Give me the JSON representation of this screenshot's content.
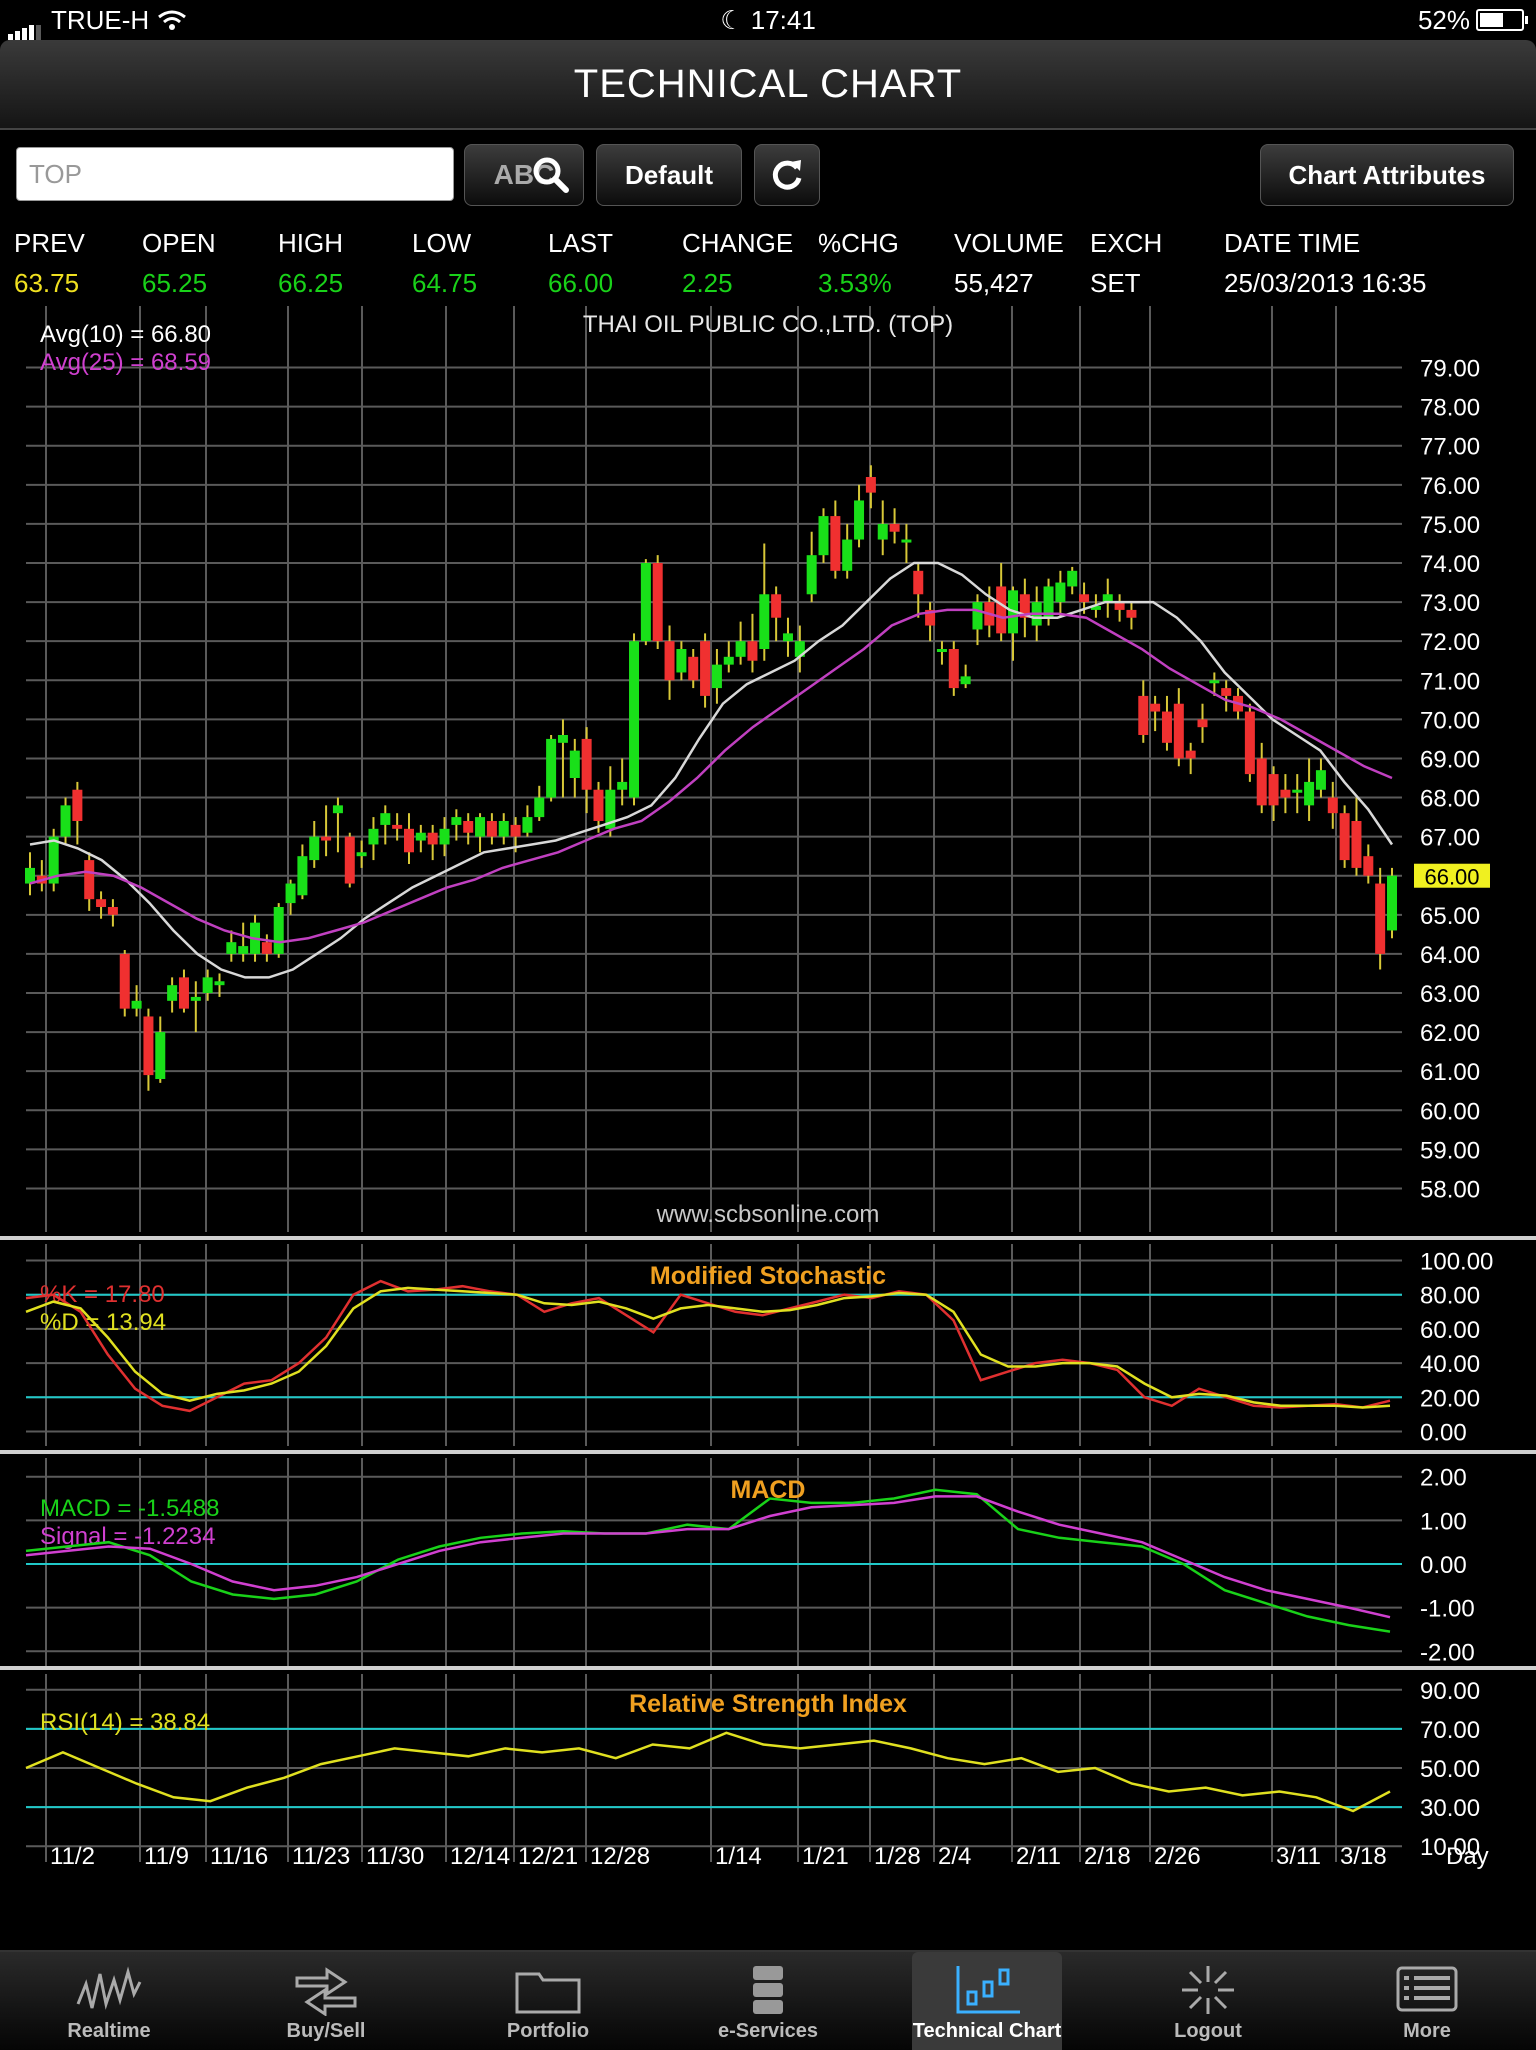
{
  "status_bar": {
    "carrier": "TRUE-H",
    "time": "17:41",
    "battery": "52%"
  },
  "title": "TECHNICAL CHART",
  "toolbar": {
    "symbol_placeholder": "TOP",
    "search_label": "ABC",
    "default_label": "Default",
    "attributes_label": "Chart Attributes"
  },
  "quote": {
    "headers": [
      "PREV",
      "OPEN",
      "HIGH",
      "LOW",
      "LAST",
      "CHANGE",
      "%CHG",
      "VOLUME",
      "EXCH",
      "DATE TIME"
    ],
    "values": [
      "63.75",
      "65.25",
      "66.25",
      "64.75",
      "66.00",
      "2.25",
      "3.53%",
      "55,427",
      "SET",
      "25/03/2013 16:35"
    ],
    "value_colors": [
      "#f0e020",
      "#19d219",
      "#19d219",
      "#19d219",
      "#19d219",
      "#19d219",
      "#19d219",
      "#ffffff",
      "#ffffff",
      "#ffffff"
    ]
  },
  "chart_data": [
    {
      "type": "candlestick",
      "title": "THAI OIL PUBLIC CO.,LTD. (TOP)",
      "watermark": "www.scbsonline.com",
      "ylim": [
        57.5,
        79.5
      ],
      "yticks": [
        "79.00",
        "78.00",
        "77.00",
        "76.00",
        "75.00",
        "74.00",
        "73.00",
        "72.00",
        "71.00",
        "70.00",
        "69.00",
        "68.00",
        "67.00",
        "66.00",
        "65.00",
        "64.00",
        "63.00",
        "62.00",
        "61.00",
        "60.00",
        "59.00",
        "58.00"
      ],
      "last_marker": "66.00",
      "legend": [
        {
          "label": "Avg(10)  =  66.80",
          "color": "#ffffff"
        },
        {
          "label": "Avg(25)  =  68.59",
          "color": "#d040d0"
        }
      ],
      "candles": [
        [
          65.8,
          66.2,
          65.5,
          66.6
        ],
        [
          66.0,
          65.8,
          65.6,
          66.4
        ],
        [
          65.8,
          67.0,
          65.6,
          67.2
        ],
        [
          67.0,
          67.8,
          66.8,
          68.0
        ],
        [
          68.2,
          67.4,
          66.8,
          68.4
        ],
        [
          66.4,
          65.4,
          65.1,
          66.6
        ],
        [
          65.4,
          65.2,
          64.9,
          65.6
        ],
        [
          65.2,
          65.0,
          64.7,
          65.4
        ],
        [
          64.0,
          62.6,
          62.4,
          64.1
        ],
        [
          62.6,
          62.8,
          62.4,
          63.2
        ],
        [
          62.4,
          60.9,
          60.5,
          62.6
        ],
        [
          60.8,
          62.0,
          60.7,
          62.4
        ],
        [
          62.8,
          63.2,
          62.5,
          63.4
        ],
        [
          63.4,
          62.6,
          62.5,
          63.6
        ],
        [
          62.8,
          62.9,
          62.0,
          63.3
        ],
        [
          63.0,
          63.4,
          62.8,
          63.6
        ],
        [
          63.2,
          63.3,
          62.9,
          63.5
        ],
        [
          64.0,
          64.3,
          63.8,
          64.6
        ],
        [
          64.0,
          64.2,
          63.8,
          64.8
        ],
        [
          64.0,
          64.8,
          63.8,
          65.0
        ],
        [
          64.3,
          64.0,
          63.8,
          64.5
        ],
        [
          64.0,
          65.2,
          63.9,
          65.3
        ],
        [
          65.3,
          65.8,
          65.0,
          65.9
        ],
        [
          65.5,
          66.5,
          65.4,
          66.8
        ],
        [
          66.4,
          67.0,
          66.2,
          67.4
        ],
        [
          67.0,
          66.9,
          66.5,
          67.8
        ],
        [
          67.6,
          67.8,
          66.6,
          68.0
        ],
        [
          67.0,
          65.8,
          65.7,
          67.1
        ],
        [
          66.5,
          66.6,
          66.2,
          66.9
        ],
        [
          66.8,
          67.2,
          66.4,
          67.5
        ],
        [
          67.3,
          67.6,
          66.8,
          67.8
        ],
        [
          67.3,
          67.2,
          66.9,
          67.6
        ],
        [
          67.2,
          66.6,
          66.3,
          67.6
        ],
        [
          66.9,
          67.1,
          66.6,
          67.3
        ],
        [
          67.1,
          66.8,
          66.4,
          67.3
        ],
        [
          66.8,
          67.2,
          66.5,
          67.5
        ],
        [
          67.3,
          67.5,
          66.9,
          67.7
        ],
        [
          67.4,
          67.1,
          66.8,
          67.6
        ],
        [
          67.0,
          67.5,
          66.6,
          67.6
        ],
        [
          67.4,
          67.0,
          66.8,
          67.6
        ],
        [
          67.0,
          67.4,
          66.8,
          67.6
        ],
        [
          67.3,
          67.0,
          66.6,
          67.5
        ],
        [
          67.1,
          67.5,
          67.0,
          67.8
        ],
        [
          67.5,
          68.0,
          67.4,
          68.3
        ],
        [
          68.0,
          69.5,
          67.9,
          69.6
        ],
        [
          69.4,
          69.6,
          68.0,
          70.0
        ],
        [
          68.5,
          69.2,
          68.0,
          69.5
        ],
        [
          69.5,
          68.2,
          67.6,
          69.8
        ],
        [
          68.2,
          67.4,
          67.1,
          68.4
        ],
        [
          67.2,
          68.2,
          67.0,
          68.8
        ],
        [
          68.2,
          68.4,
          67.8,
          69.0
        ],
        [
          68.0,
          72.0,
          67.8,
          72.2
        ],
        [
          72.0,
          74.0,
          71.9,
          74.1
        ],
        [
          74.0,
          72.0,
          71.8,
          74.2
        ],
        [
          72.0,
          71.0,
          70.5,
          72.4
        ],
        [
          71.2,
          71.8,
          71.0,
          72.0
        ],
        [
          71.6,
          71.0,
          70.8,
          71.8
        ],
        [
          72.0,
          70.6,
          70.3,
          72.2
        ],
        [
          70.8,
          71.4,
          70.4,
          71.8
        ],
        [
          71.4,
          71.6,
          71.2,
          72.0
        ],
        [
          71.6,
          72.0,
          71.4,
          72.5
        ],
        [
          72.0,
          71.5,
          71.2,
          72.7
        ],
        [
          71.8,
          73.2,
          71.5,
          74.5
        ],
        [
          73.2,
          72.6,
          72.0,
          73.4
        ],
        [
          72.0,
          72.2,
          71.6,
          72.6
        ],
        [
          71.6,
          72.0,
          71.2,
          72.4
        ],
        [
          73.2,
          74.2,
          73.0,
          74.8
        ],
        [
          74.2,
          75.2,
          74.0,
          75.4
        ],
        [
          75.2,
          73.8,
          73.6,
          75.6
        ],
        [
          73.8,
          74.6,
          73.6,
          75.0
        ],
        [
          74.6,
          75.6,
          74.4,
          76.0
        ],
        [
          76.2,
          75.8,
          75.4,
          76.5
        ],
        [
          74.6,
          75.0,
          74.2,
          75.6
        ],
        [
          75.0,
          74.8,
          74.5,
          75.4
        ],
        [
          74.6,
          74.6,
          74.0,
          75.0
        ],
        [
          73.8,
          73.2,
          72.6,
          74.0
        ],
        [
          72.8,
          72.4,
          72.0,
          73.0
        ],
        [
          71.8,
          71.8,
          71.4,
          72.0
        ],
        [
          71.8,
          70.8,
          70.6,
          72.0
        ],
        [
          70.9,
          71.1,
          70.8,
          71.4
        ],
        [
          72.3,
          73.0,
          71.9,
          73.2
        ],
        [
          73.0,
          72.4,
          72.1,
          73.4
        ],
        [
          73.4,
          72.2,
          72.0,
          74.0
        ],
        [
          72.2,
          73.3,
          71.5,
          73.4
        ],
        [
          73.2,
          72.6,
          72.1,
          73.6
        ],
        [
          72.4,
          73.0,
          72.0,
          73.4
        ],
        [
          72.6,
          73.4,
          72.4,
          73.6
        ],
        [
          73.0,
          73.5,
          72.6,
          73.8
        ],
        [
          73.4,
          73.8,
          73.2,
          73.9
        ],
        [
          73.2,
          73.0,
          72.7,
          73.5
        ],
        [
          72.8,
          72.9,
          72.6,
          73.2
        ],
        [
          73.0,
          73.2,
          72.6,
          73.6
        ],
        [
          73.0,
          72.8,
          72.5,
          73.2
        ],
        [
          72.8,
          72.6,
          72.3,
          73.0
        ],
        [
          70.6,
          69.6,
          69.4,
          71.0
        ],
        [
          70.4,
          70.2,
          69.7,
          70.6
        ],
        [
          70.2,
          69.4,
          69.2,
          70.6
        ],
        [
          70.4,
          69.0,
          68.8,
          70.8
        ],
        [
          69.2,
          69.0,
          68.6,
          69.4
        ],
        [
          70.0,
          69.8,
          69.4,
          70.4
        ],
        [
          71.0,
          71.0,
          70.6,
          71.2
        ],
        [
          70.8,
          70.6,
          70.2,
          71.0
        ],
        [
          70.6,
          70.2,
          70.0,
          70.8
        ],
        [
          70.2,
          68.6,
          68.4,
          70.4
        ],
        [
          69.0,
          67.8,
          67.6,
          69.4
        ],
        [
          68.6,
          67.8,
          67.4,
          68.8
        ],
        [
          68.2,
          68.0,
          67.6,
          68.6
        ],
        [
          68.2,
          68.2,
          67.6,
          68.6
        ],
        [
          67.8,
          68.4,
          67.4,
          69.0
        ],
        [
          68.2,
          68.7,
          68.0,
          69.0
        ],
        [
          68.0,
          67.6,
          67.2,
          68.4
        ],
        [
          67.6,
          66.4,
          66.2,
          67.8
        ],
        [
          67.4,
          66.2,
          66.0,
          68.0
        ],
        [
          66.5,
          66.0,
          65.8,
          66.8
        ],
        [
          65.8,
          64.0,
          63.6,
          66.2
        ],
        [
          64.6,
          66.0,
          64.4,
          66.2
        ]
      ],
      "ma10": [
        66.8,
        66.9,
        66.7,
        66.4,
        65.9,
        65.3,
        64.6,
        64.0,
        63.6,
        63.4,
        63.4,
        63.6,
        64.0,
        64.4,
        64.9,
        65.3,
        65.7,
        66.0,
        66.3,
        66.6,
        66.7,
        66.8,
        66.9,
        67.1,
        67.3,
        67.5,
        67.8,
        68.5,
        69.5,
        70.4,
        70.9,
        71.2,
        71.5,
        72.0,
        72.4,
        73.0,
        73.6,
        74.0,
        74.0,
        73.7,
        73.2,
        72.8,
        72.6,
        72.6,
        72.8,
        73.0,
        73.0,
        73.0,
        72.6,
        72.0,
        71.2,
        70.6,
        70.0,
        69.6,
        69.2,
        68.4,
        67.7,
        66.8
      ],
      "ma25": [
        65.8,
        66.0,
        66.1,
        66.0,
        65.7,
        65.3,
        64.9,
        64.6,
        64.4,
        64.3,
        64.4,
        64.6,
        64.8,
        65.1,
        65.4,
        65.7,
        65.9,
        66.2,
        66.4,
        66.6,
        66.9,
        67.2,
        67.4,
        67.9,
        68.5,
        69.2,
        69.8,
        70.3,
        70.8,
        71.3,
        71.8,
        72.4,
        72.7,
        72.8,
        72.8,
        72.6,
        72.7,
        72.7,
        72.6,
        72.2,
        71.8,
        71.3,
        70.9,
        70.5,
        70.3,
        70.0,
        69.6,
        69.2,
        68.8,
        68.5
      ]
    },
    {
      "type": "line",
      "title": "Modified Stochastic",
      "ylim": [
        -5,
        105
      ],
      "yticks": [
        "100.00",
        "80.00",
        "60.00",
        "40.00",
        "20.00",
        "0.00"
      ],
      "reference_lines": [
        80,
        20
      ],
      "legend": [
        {
          "label": "%K  =  17.80",
          "color": "#e03030"
        },
        {
          "label": "%D  =  13.94",
          "color": "#e0e020"
        }
      ],
      "series": [
        {
          "name": "%K",
          "color": "#e03030",
          "values": [
            78,
            80,
            70,
            45,
            25,
            15,
            12,
            20,
            28,
            30,
            40,
            55,
            80,
            88,
            82,
            83,
            85,
            82,
            80,
            70,
            75,
            78,
            68,
            58,
            80,
            75,
            70,
            68,
            72,
            76,
            80,
            78,
            82,
            80,
            65,
            30,
            35,
            40,
            42,
            40,
            36,
            20,
            15,
            25,
            20,
            15,
            14,
            15,
            16,
            14,
            18
          ]
        },
        {
          "name": "%D",
          "color": "#e0e020",
          "values": [
            70,
            76,
            72,
            55,
            35,
            22,
            18,
            22,
            24,
            28,
            35,
            50,
            72,
            82,
            84,
            83,
            82,
            81,
            80,
            75,
            74,
            76,
            72,
            66,
            72,
            74,
            72,
            70,
            71,
            74,
            78,
            79,
            81,
            80,
            70,
            45,
            38,
            38,
            40,
            40,
            38,
            28,
            20,
            22,
            21,
            17,
            15,
            15,
            15,
            14,
            15
          ]
        }
      ]
    },
    {
      "type": "line",
      "title": "MACD",
      "ylim": [
        -2.2,
        2.2
      ],
      "yticks": [
        "2.00",
        "1.00",
        "0.00",
        "-1.00",
        "-2.00"
      ],
      "reference_lines": [
        0
      ],
      "legend": [
        {
          "label": "MACD  =  -1.5488",
          "color": "#19d219"
        },
        {
          "label": "Signal  =  -1.2234",
          "color": "#d040d0"
        }
      ],
      "series": [
        {
          "name": "MACD",
          "color": "#19d219",
          "values": [
            0.3,
            0.4,
            0.5,
            0.2,
            -0.4,
            -0.7,
            -0.8,
            -0.7,
            -0.4,
            0.1,
            0.4,
            0.6,
            0.7,
            0.75,
            0.7,
            0.7,
            0.9,
            0.8,
            1.5,
            1.4,
            1.4,
            1.5,
            1.7,
            1.6,
            0.8,
            0.6,
            0.5,
            0.4,
            0.0,
            -0.6,
            -0.9,
            -1.2,
            -1.4,
            -1.55
          ]
        },
        {
          "name": "Signal",
          "color": "#d040d0",
          "values": [
            0.2,
            0.3,
            0.4,
            0.35,
            0.0,
            -0.4,
            -0.6,
            -0.5,
            -0.3,
            0.0,
            0.3,
            0.5,
            0.6,
            0.7,
            0.7,
            0.7,
            0.8,
            0.8,
            1.1,
            1.3,
            1.35,
            1.4,
            1.55,
            1.55,
            1.2,
            0.9,
            0.7,
            0.5,
            0.1,
            -0.3,
            -0.6,
            -0.8,
            -1.0,
            -1.22
          ]
        }
      ]
    },
    {
      "type": "line",
      "title": "Relative Strength Index",
      "ylim": [
        5,
        95
      ],
      "yticks": [
        "90.00",
        "70.00",
        "50.00",
        "30.00",
        "10.00"
      ],
      "reference_lines": [
        70,
        30
      ],
      "legend": [
        {
          "label": "RSI(14)  =  38.84",
          "color": "#e0e020"
        }
      ],
      "series": [
        {
          "name": "RSI(14)",
          "color": "#e0e020",
          "values": [
            50,
            58,
            50,
            42,
            35,
            33,
            40,
            45,
            52,
            56,
            60,
            58,
            56,
            60,
            58,
            60,
            55,
            62,
            60,
            68,
            62,
            60,
            62,
            64,
            60,
            55,
            52,
            55,
            48,
            50,
            42,
            38,
            40,
            36,
            38,
            35,
            28,
            38
          ]
        }
      ]
    }
  ],
  "x_axis": {
    "labels": [
      "11/2",
      "11/9",
      "11/16",
      "11/23",
      "11/30",
      "12/14",
      "12/21",
      "12/28",
      "1/14",
      "1/21",
      "1/28",
      "2/4",
      "2/11",
      "2/18",
      "2/26",
      "3/11",
      "3/18"
    ],
    "unit": "Day"
  },
  "tab_bar": {
    "tabs": [
      {
        "label": "Realtime",
        "icon": "realtime-icon"
      },
      {
        "label": "Buy/Sell",
        "icon": "buy-sell-icon"
      },
      {
        "label": "Portfolio",
        "icon": "folder-icon"
      },
      {
        "label": "e-Services",
        "icon": "server-icon"
      },
      {
        "label": "Technical Chart",
        "icon": "chart-icon",
        "active": true
      },
      {
        "label": "Logout",
        "icon": "logout-icon"
      },
      {
        "label": "More",
        "icon": "list-icon"
      }
    ]
  }
}
